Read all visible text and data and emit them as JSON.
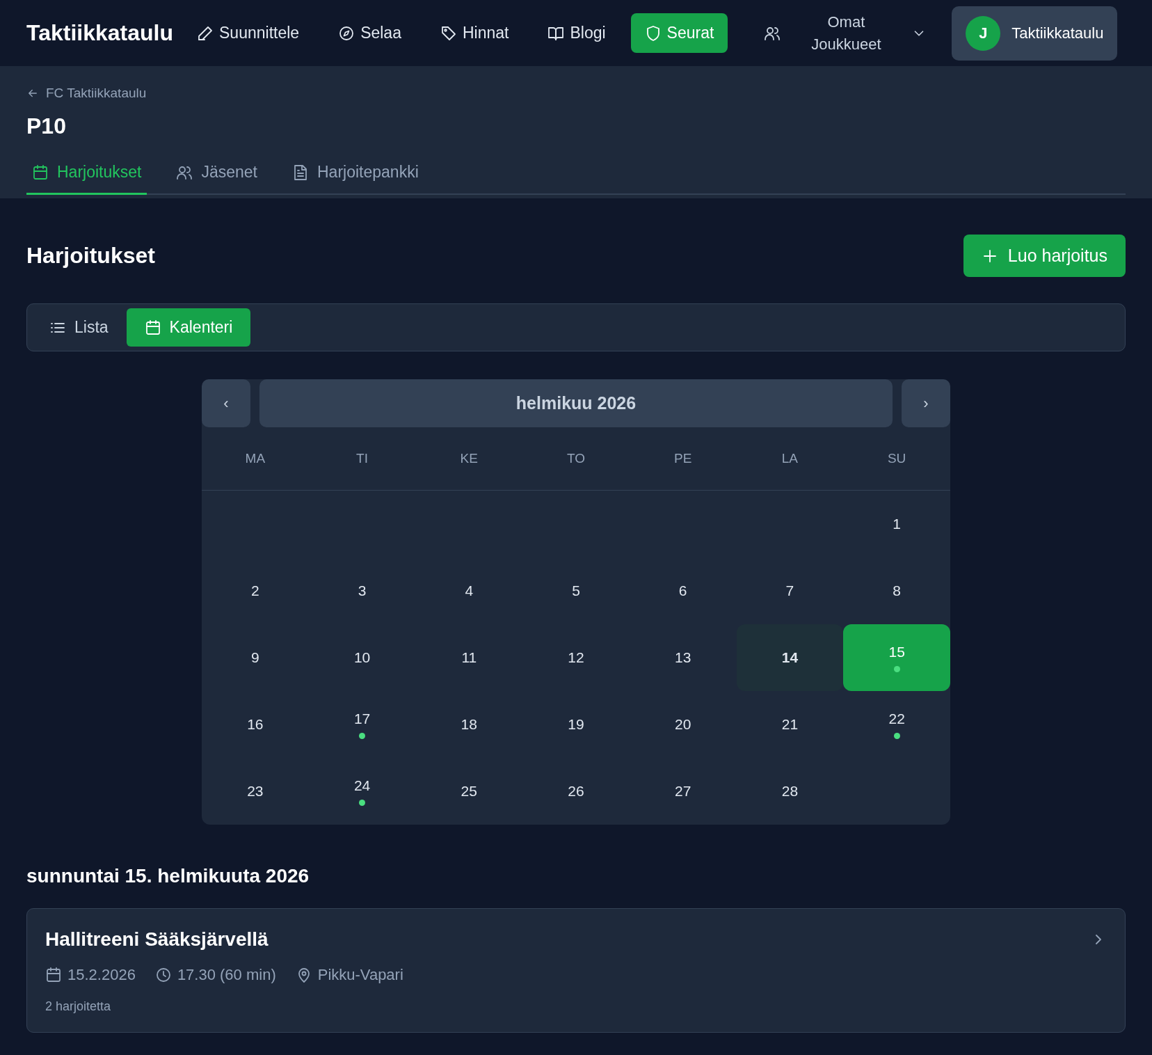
{
  "nav": {
    "brand": "Taktiikkataulu",
    "links": [
      {
        "label": "Suunnittele",
        "kind": "pencil",
        "selected": false
      },
      {
        "label": "Selaa",
        "kind": "compass",
        "selected": false
      },
      {
        "label": "Hinnat",
        "kind": "tag",
        "selected": false
      },
      {
        "label": "Blogi",
        "kind": "book",
        "selected": false
      },
      {
        "label": "Seurat",
        "kind": "shield",
        "selected": true
      }
    ],
    "teams": {
      "label": "Omat Joukkueet"
    },
    "user": {
      "initial": "J",
      "name": "Taktiikkataulu"
    }
  },
  "header": {
    "back": "FC Taktiikkataulu",
    "title": "P10",
    "tabs": [
      {
        "label": "Harjoitukset",
        "kind": "calendar",
        "selected": true
      },
      {
        "label": "Jäsenet",
        "kind": "users",
        "selected": false
      },
      {
        "label": "Harjoitepankki",
        "kind": "doc",
        "selected": false
      }
    ]
  },
  "section": {
    "title": "Harjoitukset",
    "create_button": "Luo harjoitus"
  },
  "view_toggle": [
    {
      "label": "Lista",
      "kind": "list",
      "selected": false
    },
    {
      "label": "Kalenteri",
      "kind": "calendar",
      "selected": true
    }
  ],
  "calendar": {
    "prev": "‹",
    "month": "helmikuu 2026",
    "next": "›",
    "weekdays": [
      "MA",
      "TI",
      "KE",
      "TO",
      "PE",
      "LA",
      "SU"
    ],
    "days": [
      {
        "kind": "blank"
      },
      {
        "kind": "blank"
      },
      {
        "kind": "blank"
      },
      {
        "kind": "blank"
      },
      {
        "kind": "blank"
      },
      {
        "kind": "blank"
      },
      {
        "kind": "day",
        "label": "1",
        "today": false,
        "selected": false,
        "event": false
      },
      {
        "kind": "day",
        "label": "2",
        "today": false,
        "selected": false,
        "event": false
      },
      {
        "kind": "day",
        "label": "3",
        "today": false,
        "selected": false,
        "event": false
      },
      {
        "kind": "day",
        "label": "4",
        "today": false,
        "selected": false,
        "event": false
      },
      {
        "kind": "day",
        "label": "5",
        "today": false,
        "selected": false,
        "event": false
      },
      {
        "kind": "day",
        "label": "6",
        "today": false,
        "selected": false,
        "event": false
      },
      {
        "kind": "day",
        "label": "7",
        "today": false,
        "selected": false,
        "event": false
      },
      {
        "kind": "day",
        "label": "8",
        "today": false,
        "selected": false,
        "event": false
      },
      {
        "kind": "day",
        "label": "9",
        "today": false,
        "selected": false,
        "event": false
      },
      {
        "kind": "day",
        "label": "10",
        "today": false,
        "selected": false,
        "event": false
      },
      {
        "kind": "day",
        "label": "11",
        "today": false,
        "selected": false,
        "event": false
      },
      {
        "kind": "day",
        "label": "12",
        "today": false,
        "selected": false,
        "event": false
      },
      {
        "kind": "day",
        "label": "13",
        "today": false,
        "selected": false,
        "event": false
      },
      {
        "kind": "day",
        "label": "14",
        "today": true,
        "selected": false,
        "event": false
      },
      {
        "kind": "day",
        "label": "15",
        "today": false,
        "selected": true,
        "event": true
      },
      {
        "kind": "day",
        "label": "16",
        "today": false,
        "selected": false,
        "event": false
      },
      {
        "kind": "day",
        "label": "17",
        "today": false,
        "selected": false,
        "event": true
      },
      {
        "kind": "day",
        "label": "18",
        "today": false,
        "selected": false,
        "event": false
      },
      {
        "kind": "day",
        "label": "19",
        "today": false,
        "selected": false,
        "event": false
      },
      {
        "kind": "day",
        "label": "20",
        "today": false,
        "selected": false,
        "event": false
      },
      {
        "kind": "day",
        "label": "21",
        "today": false,
        "selected": false,
        "event": false
      },
      {
        "kind": "day",
        "label": "22",
        "today": false,
        "selected": false,
        "event": true
      },
      {
        "kind": "day",
        "label": "23",
        "today": false,
        "selected": false,
        "event": false
      },
      {
        "kind": "day",
        "label": "24",
        "today": false,
        "selected": false,
        "event": true
      },
      {
        "kind": "day",
        "label": "25",
        "today": false,
        "selected": false,
        "event": false
      },
      {
        "kind": "day",
        "label": "26",
        "today": false,
        "selected": false,
        "event": false
      },
      {
        "kind": "day",
        "label": "27",
        "today": false,
        "selected": false,
        "event": false
      },
      {
        "kind": "day",
        "label": "28",
        "today": false,
        "selected": false,
        "event": false
      }
    ]
  },
  "selected_date": "sunnuntai 15. helmikuuta 2026",
  "sessions": [
    {
      "title": "Hallitreeni Sääksjärvellä",
      "date": "15.2.2026",
      "time": "17.30 (60 min)",
      "place": "Pikku-Vapari",
      "count": "2 harjoitetta"
    }
  ]
}
